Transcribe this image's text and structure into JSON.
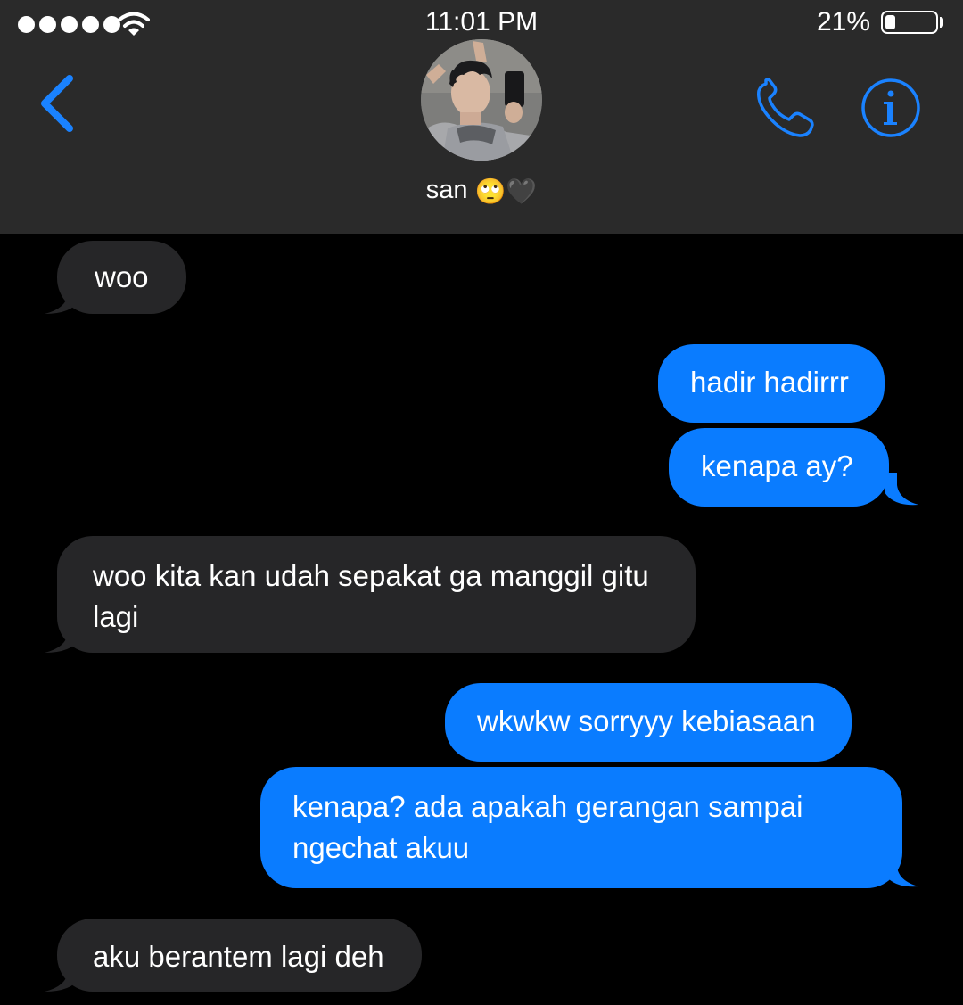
{
  "status_bar": {
    "time": "11:01 PM",
    "battery_percent_label": "21%",
    "battery_level": 0.21,
    "signal_dots": 5
  },
  "nav": {
    "contact_name": "san",
    "contact_emoji": "🙄🖤",
    "accent_color": "#1a82ff"
  },
  "messages": [
    {
      "direction": "incoming",
      "text": "woo"
    },
    {
      "direction": "outgoing",
      "text": "hadir hadirrr"
    },
    {
      "direction": "outgoing",
      "text": "kenapa ay?"
    },
    {
      "direction": "incoming",
      "text": "woo kita kan udah sepakat ga manggil gitu lagi"
    },
    {
      "direction": "outgoing",
      "text": "wkwkw sorryyy kebiasaan"
    },
    {
      "direction": "outgoing",
      "text": "kenapa? ada apakah gerangan sampai ngechat akuu"
    },
    {
      "direction": "incoming",
      "text": "aku berantem lagi deh"
    }
  ],
  "colors": {
    "header_bg": "#2a2a2a",
    "incoming_bubble": "#262628",
    "outgoing_bubble": "#0a7cff",
    "background": "#000000"
  }
}
